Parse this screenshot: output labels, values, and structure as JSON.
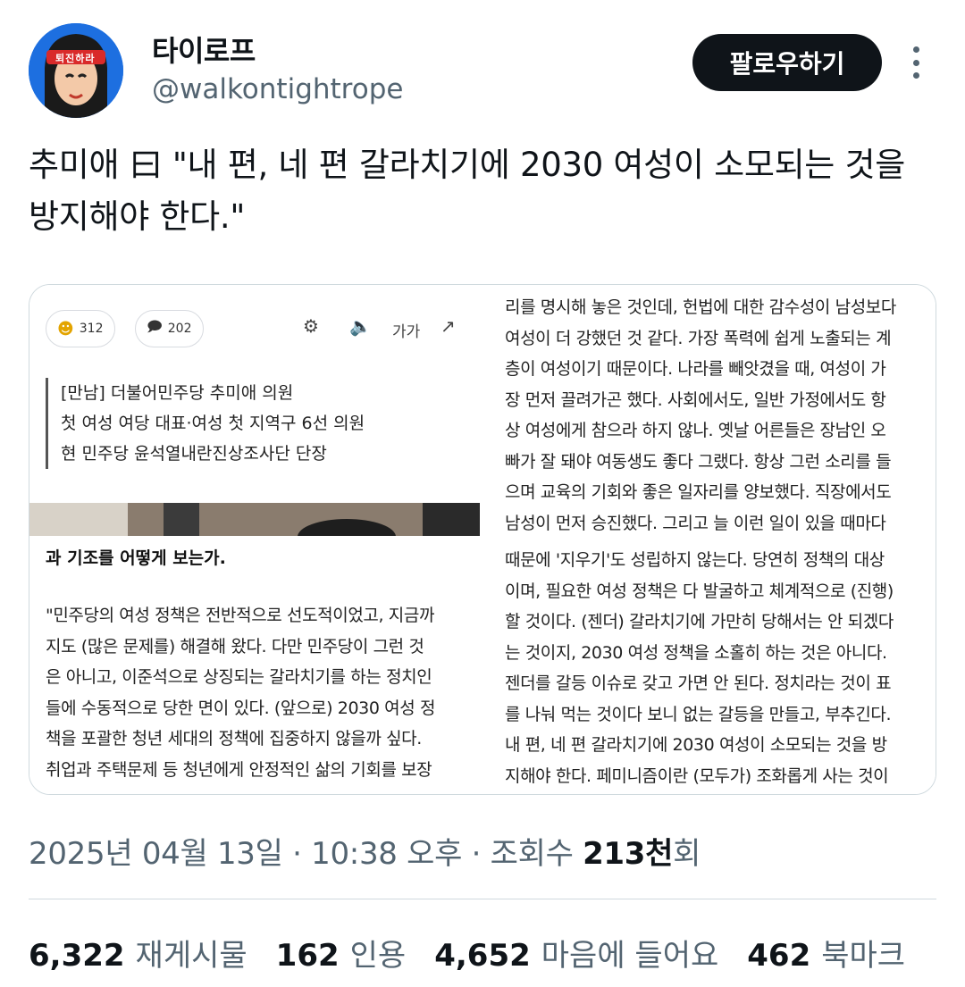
{
  "author": {
    "name": "타이로프",
    "handle": "@walkontightrope",
    "avatar_headband_text": "퇴진하라"
  },
  "follow_button": "팔로우하기",
  "tweet_text": "추미애 曰 \"내 편, 네 편 갈라치기에 2030 여성이 소모되는 것을 방지해야 한다.\"",
  "media": {
    "tile1": {
      "like_count": "312",
      "comment_count": "202",
      "font_size_label": "가가",
      "quote_lines": [
        "[만남] 더불어민주당 추미애 의원",
        "첫 여성 여당 대표·여성 첫 지역구 6선 의원",
        "현 민주당 윤석열내란진상조사단 단장"
      ]
    },
    "tile2": {
      "lines": [
        "리를 명시해 놓은 것인데, 헌법에 대한 감수성이 남성보다",
        "여성이 더 강했던 것 같다. 가장 폭력에 쉽게 노출되는 계",
        "층이 여성이기 때문이다. 나라를 빼앗겼을 때, 여성이 가",
        "장 먼저 끌려가곤 했다. 사회에서도, 일반 가정에서도 항",
        "상 여성에게 참으라 하지 않나. 옛날 어른들은 장남인 오",
        "빠가 잘 돼야 여동생도 좋다 그랬다. 항상 그런 소리를 들",
        "으며 교육의 기회와 좋은 일자리를 양보했다. 직장에서도",
        "남성이 먼저 승진했다. 그리고 늘 이런 일이 있을 때마다"
      ]
    },
    "tile3": {
      "heading": "과 기조를 어떻게 보는가.",
      "lines": [
        "\"민주당의 여성 정책은 전반적으로 선도적이었고, 지금까",
        "지도 (많은 문제를) 해결해 왔다. 다만 민주당이 그런 것",
        "은 아니고, 이준석으로 상징되는 갈라치기를 하는 정치인",
        "들에 수동적으로 당한 면이 있다. (앞으로) 2030 여성 정",
        "책을 포괄한 청년 세대의 정책에 집중하지 않을까 싶다.",
        "취업과 주택문제 등 청년에게 안정적인 삶의 기회를 보장"
      ]
    },
    "tile4": {
      "lines": [
        "때문에 '지우기'도 성립하지 않는다. 당연히 정책의 대상",
        "이며, 필요한 여성 정책은 다 발굴하고 체계적으로 (진행)",
        "할 것이다. (젠더) 갈라치기에 가만히 당해서는 안 되겠다",
        "는 것이지, 2030 여성 정책을 소홀히 하는 것은 아니다.",
        "젠더를 갈등 이슈로 갖고 가면 안 된다. 정치라는 것이 표",
        "를 나눠 먹는 것이다 보니 없는 갈등을 만들고, 부추긴다.",
        "내 편, 네 편 갈라치기에 2030 여성이 소모되는 것을 방",
        "지해야 한다. 페미니즘이란 (모두가) 조화롭게 사는 것이"
      ]
    }
  },
  "meta": {
    "timestamp": "2025년 04월 13일 · 10:38 오후 · 조회수 ",
    "views_number": "213천",
    "views_suffix": "회"
  },
  "stats": {
    "retweets": "6,322",
    "retweets_label": "재게시물",
    "quotes": "162",
    "quotes_label": "인용",
    "likes": "4,652",
    "likes_label": "마음에 들어요",
    "bookmarks": "462",
    "bookmarks_label": "북마크"
  },
  "colors": {
    "text": "#0f1419",
    "secondary": "#536471",
    "border": "#cfd9de",
    "avatar_bg": "#1d6fe0",
    "headband": "#d92a2a"
  }
}
